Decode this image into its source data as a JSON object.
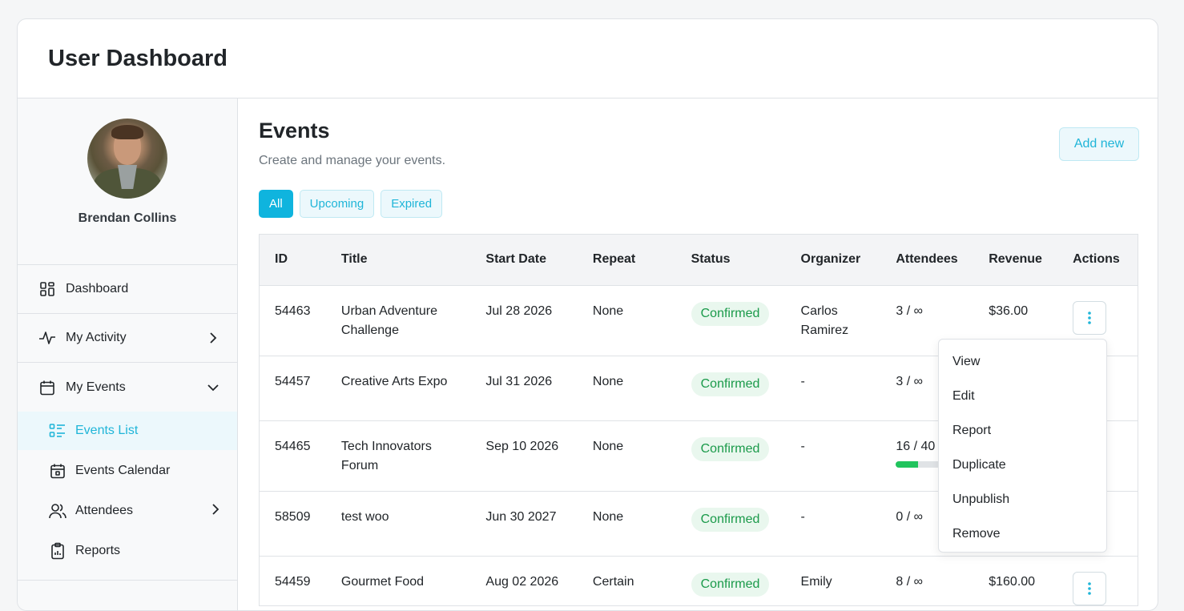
{
  "header": {
    "title": "User Dashboard"
  },
  "profile": {
    "name": "Brendan Collins"
  },
  "sidebar": {
    "items": [
      {
        "label": "Dashboard",
        "icon": "dashboard-icon"
      },
      {
        "label": "My Activity",
        "icon": "activity-icon"
      },
      {
        "label": "My Events",
        "icon": "calendar-icon"
      }
    ],
    "sub_items": [
      {
        "label": "Events List",
        "icon": "list-icon"
      },
      {
        "label": "Events Calendar",
        "icon": "calendar-icon"
      },
      {
        "label": "Attendees",
        "icon": "users-icon"
      },
      {
        "label": "Reports",
        "icon": "clipboard-icon"
      }
    ]
  },
  "main": {
    "title": "Events",
    "subtitle": "Create and manage your events.",
    "add_label": "Add new",
    "filters": [
      "All",
      "Upcoming",
      "Expired"
    ]
  },
  "table": {
    "columns": [
      "ID",
      "Title",
      "Start Date",
      "Repeat",
      "Status",
      "Organizer",
      "Attendees",
      "Revenue",
      "Actions"
    ],
    "rows": [
      {
        "id": "54463",
        "title": "Urban Adventure Challenge",
        "start": "Jul 28 2026",
        "repeat": "None",
        "status": "Confirmed",
        "organizer": "Carlos Ramirez",
        "attendees": "3 / ∞",
        "revenue": "$36.00",
        "progress": null
      },
      {
        "id": "54457",
        "title": "Creative Arts Expo",
        "start": "Jul 31 2026",
        "repeat": "None",
        "status": "Confirmed",
        "organizer": "-",
        "attendees": "3 / ∞",
        "revenue": "",
        "progress": null
      },
      {
        "id": "54465",
        "title": "Tech Innovators Forum",
        "start": "Sep 10 2026",
        "repeat": "None",
        "status": "Confirmed",
        "organizer": "-",
        "attendees": "16 / 40",
        "revenue": "",
        "progress": 0.4
      },
      {
        "id": "58509",
        "title": "test woo",
        "start": "Jun 30 2027",
        "repeat": "None",
        "status": "Confirmed",
        "organizer": "-",
        "attendees": "0 / ∞",
        "revenue": "",
        "progress": null
      },
      {
        "id": "54459",
        "title": "Gourmet Food",
        "start": "Aug 02 2026",
        "repeat": "Certain",
        "status": "Confirmed",
        "organizer": "Emily",
        "attendees": "8 / ∞",
        "revenue": "$160.00",
        "progress": null
      }
    ]
  },
  "dropdown": {
    "items": [
      "View",
      "Edit",
      "Report",
      "Duplicate",
      "Unpublish",
      "Remove"
    ]
  },
  "colors": {
    "accent": "#0fb4de",
    "accent_light": "#ecf8fc",
    "success": "#1a9a4a",
    "success_bg": "#e9f7ee",
    "progress": "#21c45d"
  }
}
